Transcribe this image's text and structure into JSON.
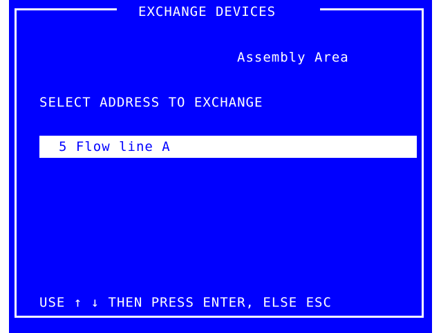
{
  "window": {
    "title": "EXCHANGE DEVICES",
    "area": "Assembly Area"
  },
  "prompt": "SELECT ADDRESS TO EXCHANGE",
  "list": {
    "items": [
      {
        "label": "5 Flow line A",
        "selected": true
      }
    ]
  },
  "footer": {
    "hint": "USE ↑ ↓ THEN PRESS ENTER, ELSE ESC"
  },
  "colors": {
    "background": "#0000ff",
    "foreground": "#ffffff",
    "highlight": "#ffffff",
    "highlight_text": "#0000ff"
  }
}
